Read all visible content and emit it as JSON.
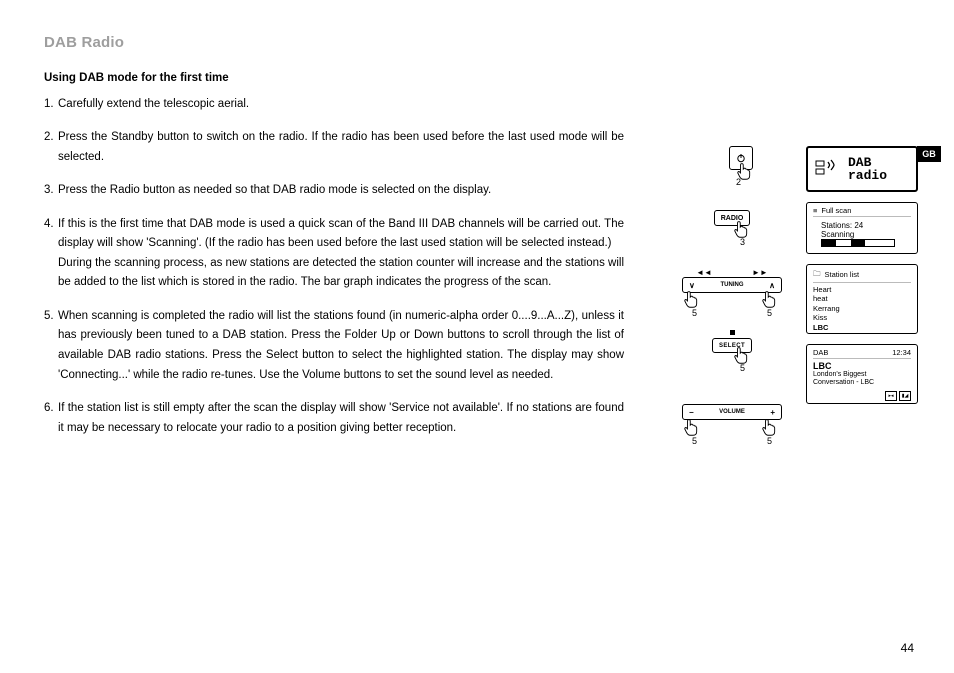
{
  "title": "DAB Radio",
  "subtitle": "Using DAB mode for the first time",
  "gb_tab": "GB",
  "page_number": "44",
  "steps": [
    {
      "n": "1.",
      "t": "Carefully extend the telescopic aerial."
    },
    {
      "n": "2.",
      "t": "Press the Standby button to switch on the radio. If the radio has been used before the last used mode will be selected."
    },
    {
      "n": "3.",
      "t": "Press the Radio button as needed so that DAB radio mode is selected on the display."
    },
    {
      "n": "4.",
      "t": "If this is the first time that DAB mode is used a quick scan of the Band III DAB channels will be carried out. The display will show 'Scanning'. (If the radio has been used before the last used station will be selected instead.)\nDuring the scanning process, as new stations are detected the station counter will increase and the stations will be added to the list which is stored in the radio. The bar graph indicates the progress of the scan."
    },
    {
      "n": "5.",
      "t": "When scanning is completed the radio will list the stations found (in numeric-alpha order 0....9...A...Z), unless it has previously been tuned to a DAB station. Press the Folder Up or Down buttons to scroll through the list of available DAB radio stations. Press the Select button to select the highlighted station. The display may show 'Connecting...' while the radio re-tunes. Use the Volume buttons to set the sound level as needed."
    },
    {
      "n": "6.",
      "t": "If the station list is still empty after the scan the display will show 'Service not available'. If no stations are found it may be necessary to relocate your radio to a position giving better reception."
    }
  ],
  "figures": {
    "standby_step": "2",
    "radio_label": "RADIO",
    "radio_step": "3",
    "tuning_left": "◄◄",
    "tuning_right": "►►",
    "tuning_v": "∨",
    "tuning_a": "∧",
    "tuning_label": "TUNING",
    "tuning_step_l": "5",
    "tuning_step_r": "5",
    "select_label": "SELECT",
    "select_step": "5",
    "volume_minus": "−",
    "volume_plus": "+",
    "volume_label": "VOLUME",
    "volume_step_l": "5",
    "volume_step_r": "5"
  },
  "screens": {
    "s1_line1": "DAB",
    "s1_line2": "radio",
    "s2_header": "Full scan",
    "s2_l1": "Stations: 24",
    "s2_l2": "Scanning",
    "s3_header": "Station list",
    "s3_items": [
      "Heart",
      "heat",
      "Kerrang",
      "Kiss",
      "LBC"
    ],
    "s3_selected_index": 4,
    "s4_mode": "DAB",
    "s4_time": "12:34",
    "s4_station": "LBC",
    "s4_desc1": "London's Biggest",
    "s4_desc2": "Conversation   - LBC"
  }
}
